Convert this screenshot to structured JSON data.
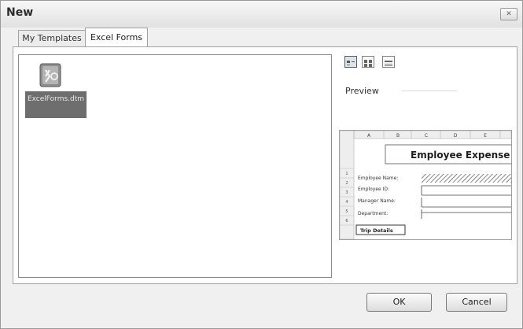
{
  "window": {
    "title": "New"
  },
  "tabs": [
    {
      "label": "My Templates",
      "active": false
    },
    {
      "label": "Excel Forms",
      "active": true
    }
  ],
  "files": [
    {
      "name": "ExcelForms.dtm",
      "selected": true,
      "icon": "form-template-icon"
    }
  ],
  "view_buttons": [
    {
      "icon": "large-icons-view-icon",
      "selected": true
    },
    {
      "icon": "list-view-icon",
      "selected": false
    },
    {
      "icon": "details-view-icon",
      "selected": false
    }
  ],
  "preview": {
    "label": "Preview",
    "sheet": {
      "columns": [
        "A",
        "B",
        "C",
        "D",
        "E"
      ],
      "rows": [
        "1",
        "2",
        "3",
        "4",
        "5",
        "6"
      ],
      "heading": "Employee Expense",
      "fields": [
        "Employee Name:",
        "Employee ID:",
        "Manager Name:",
        "Department:"
      ],
      "section": "Trip Details"
    }
  },
  "buttons": {
    "ok": "OK",
    "cancel": "Cancel"
  },
  "colors": {
    "selection": "#6e6e6e",
    "dialog_bg": "#f0f0f0"
  }
}
